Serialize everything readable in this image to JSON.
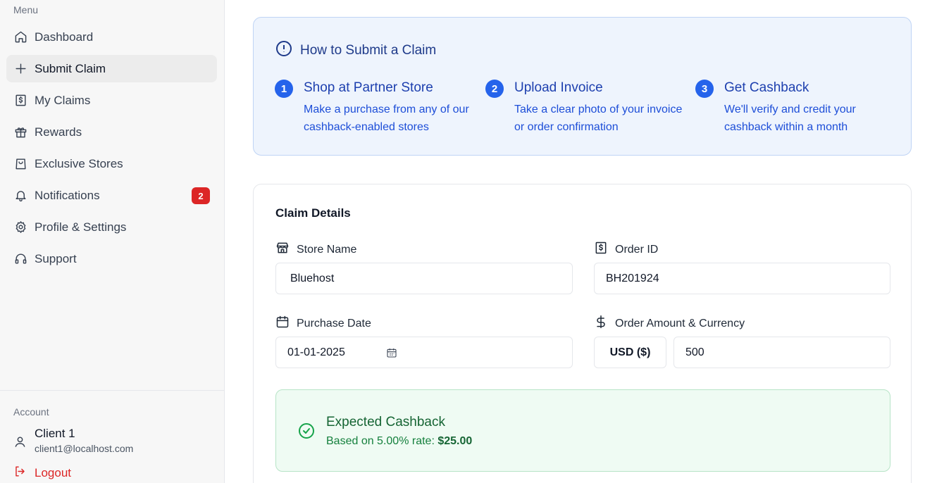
{
  "sidebar": {
    "menu_label": "Menu",
    "items": [
      {
        "label": "Dashboard",
        "icon": "home-icon"
      },
      {
        "label": "Submit Claim",
        "icon": "plus-icon",
        "active": true
      },
      {
        "label": "My Claims",
        "icon": "receipt-icon"
      },
      {
        "label": "Rewards",
        "icon": "gift-icon"
      },
      {
        "label": "Exclusive Stores",
        "icon": "shopping-bag-icon"
      },
      {
        "label": "Notifications",
        "icon": "bell-icon",
        "badge": "2"
      },
      {
        "label": "Profile & Settings",
        "icon": "gear-icon"
      },
      {
        "label": "Support",
        "icon": "headphones-icon"
      }
    ],
    "account_label": "Account",
    "user": {
      "name": "Client 1",
      "email": "client1@localhost.com"
    },
    "logout_label": "Logout"
  },
  "info": {
    "title": "How to Submit a Claim",
    "steps": [
      {
        "number": "1",
        "title": "Shop at Partner Store",
        "desc": "Make a purchase from any of our cashback-enabled stores"
      },
      {
        "number": "2",
        "title": "Upload Invoice",
        "desc": "Take a clear photo of your invoice or order confirmation"
      },
      {
        "number": "3",
        "title": "Get Cashback",
        "desc": "We'll verify and credit your cashback within a month"
      }
    ]
  },
  "form": {
    "title": "Claim Details",
    "store_label": "Store Name",
    "store_value": "Bluehost",
    "order_id_label": "Order ID",
    "order_id_value": "BH201924",
    "date_label": "Purchase Date",
    "date_value": "01-01-2025",
    "amount_label": "Order Amount & Currency",
    "currency_value": "USD ($)",
    "amount_value": "500"
  },
  "cashback": {
    "title": "Expected Cashback",
    "rate_text": "Based on 5.00% rate: ",
    "amount": "$25.00"
  },
  "colors": {
    "primary": "#2563eb",
    "badge": "#dc2626",
    "success": "#16a34a",
    "info_bg": "#eef4fd"
  }
}
